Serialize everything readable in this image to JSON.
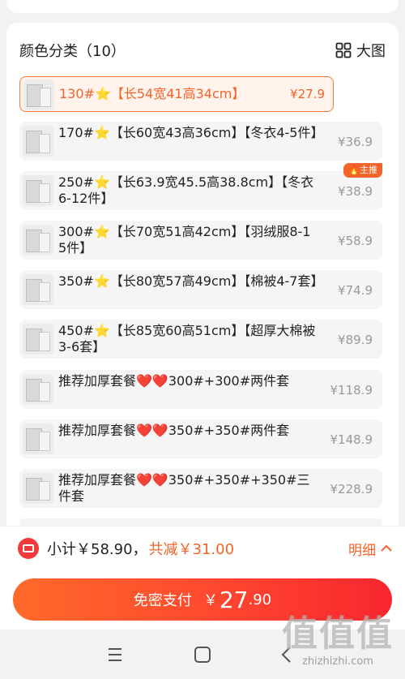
{
  "section": {
    "title": "颜色分类（10）",
    "big_image_label": "大图"
  },
  "options": [
    {
      "label": "130#⭐【长54宽41高34cm】",
      "price": "¥27.9",
      "selected": true
    },
    {
      "label": "170#⭐【长60宽43高36cm】【冬衣4-5件】",
      "price": "¥36.9"
    },
    {
      "label": "250#⭐【长63.9宽45.5高38.8cm】【冬衣6-12件】",
      "price": "¥38.9",
      "badge": "主推"
    },
    {
      "label": "300#⭐【长70宽51高42cm】【羽绒服8-15件】",
      "price": "¥58.9"
    },
    {
      "label": "350#⭐【长80宽57高49cm】【棉被4-7套】",
      "price": "¥74.9"
    },
    {
      "label": "450#⭐【长85宽60高51cm】【超厚大棉被3-6套】",
      "price": "¥89.9"
    },
    {
      "label": "推荐加厚套餐❤️❤️300#+300#两件套",
      "price": "¥118.9"
    },
    {
      "label": "推荐加厚套餐❤️❤️350#+350#两件套",
      "price": "¥148.9"
    },
    {
      "label": "推荐加厚套餐❤️❤️350#+350#+350#三件套",
      "price": "¥228.9"
    }
  ],
  "summary": {
    "subtotal": "小计￥58.90，",
    "discount": "共减￥31.00",
    "detail_label": "明细"
  },
  "pay": {
    "label": "免密支付",
    "currency": "￥",
    "amount_int": "27",
    "amount_dec": ".90"
  },
  "watermark": {
    "glyphs": "值值值",
    "url": "zhizhizhi.com"
  },
  "colors": {
    "accent": "#f2642a",
    "pay_gradient_start": "#ff6a2a",
    "pay_gradient_end": "#f8262f"
  }
}
